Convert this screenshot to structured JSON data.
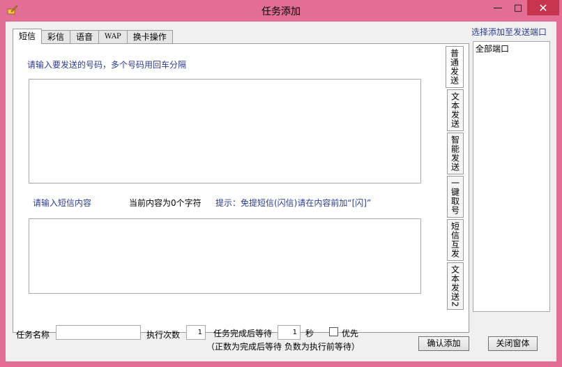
{
  "window": {
    "title": "任务添加",
    "min_glyph": "—",
    "max_glyph": "□",
    "close_glyph": "✕"
  },
  "tabs": [
    "短信",
    "彩信",
    "语音",
    "WAP",
    "换卡操作"
  ],
  "side_tabs": [
    "普通发送",
    "文本发送",
    "智能发送",
    "一键取号",
    "短信互发",
    "文本发送2"
  ],
  "sms": {
    "numbers_label": "请输入要发送的号码，多个号码用回车分隔",
    "content_label": "请输入短信内容",
    "char_count": "当前内容为0个字符",
    "hint": "提示：免提短信(闪信)请在内容前加“[闪]”"
  },
  "ports": {
    "title": "选择添加至发送端口",
    "items": [
      "全部端口"
    ]
  },
  "bottom": {
    "task_name_label": "任务名称",
    "task_name_value": "",
    "exec_count_label": "执行次数",
    "exec_count_value": "1",
    "wait_label": "任务完成后等待",
    "wait_value": "1",
    "seconds_label": "秒",
    "priority_label": "优先",
    "note": "（正数为完成后等待 负数为执行前等待）",
    "confirm_label": "确认添加",
    "close_label": "关闭窗体"
  }
}
